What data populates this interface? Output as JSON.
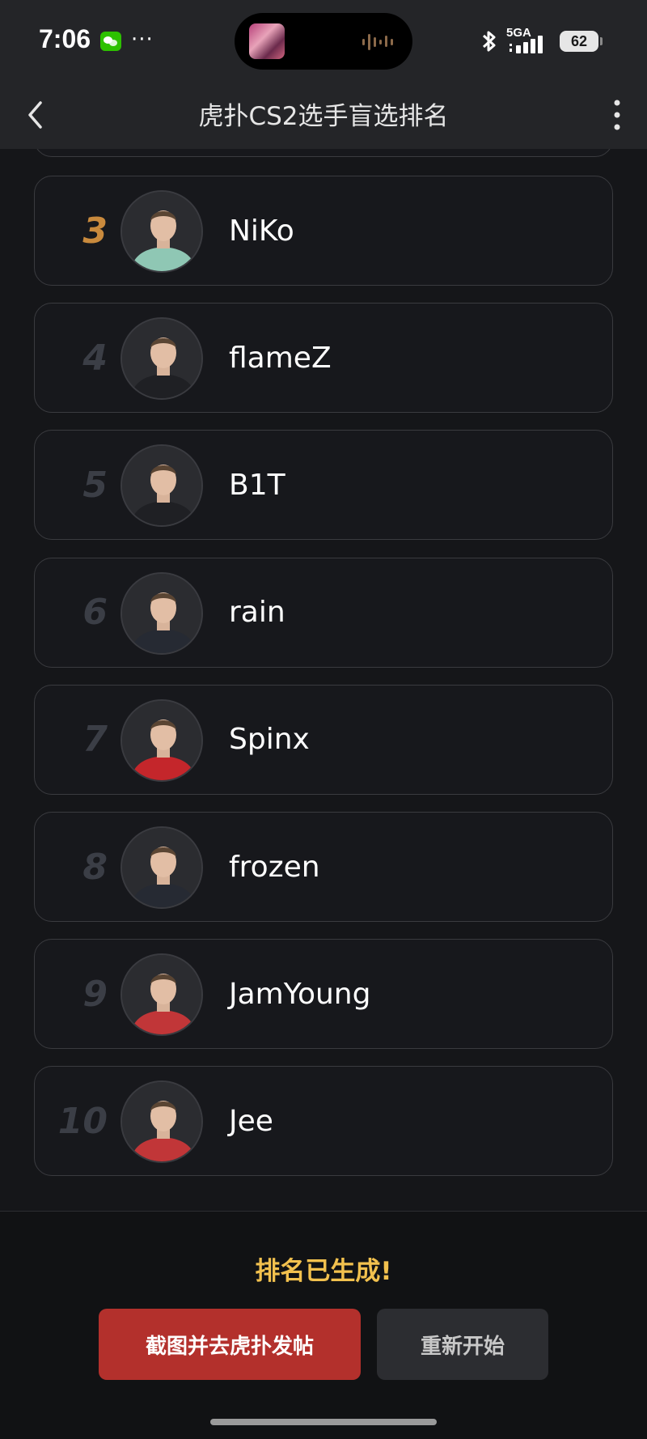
{
  "status_bar": {
    "time": "7:06",
    "more": "···",
    "network": "5GA",
    "battery": "62",
    "icons": [
      "wechat-icon",
      "bluetooth-icon",
      "signal-icon",
      "battery-icon"
    ]
  },
  "nav": {
    "title": "虎扑CS2选手盲选排名",
    "back_icon": "chevron-left-icon",
    "menu_icon": "vertical-dots-icon"
  },
  "players": [
    {
      "rank": "3",
      "name": "NiKo",
      "jersey": "#8fc7b4",
      "highlight": true
    },
    {
      "rank": "4",
      "name": "flameZ",
      "jersey": "#1f2024",
      "highlight": false
    },
    {
      "rank": "5",
      "name": "B1T",
      "jersey": "#1f2024",
      "highlight": false
    },
    {
      "rank": "6",
      "name": "rain",
      "jersey": "#262a33",
      "highlight": false
    },
    {
      "rank": "7",
      "name": "Spinx",
      "jersey": "#c4262b",
      "highlight": false
    },
    {
      "rank": "8",
      "name": "frozen",
      "jersey": "#262a33",
      "highlight": false
    },
    {
      "rank": "9",
      "name": "JamYoung",
      "jersey": "#c13638",
      "highlight": false
    },
    {
      "rank": "10",
      "name": "Jee",
      "jersey": "#c13638",
      "highlight": false
    }
  ],
  "footer": {
    "status": "排名已生成!",
    "primary_button": "截图并去虎扑发帖",
    "secondary_button": "重新开始"
  },
  "colors": {
    "accent_gold": "#f2c14e",
    "top_rank": "#c98a3d",
    "primary": "#b3302c"
  }
}
